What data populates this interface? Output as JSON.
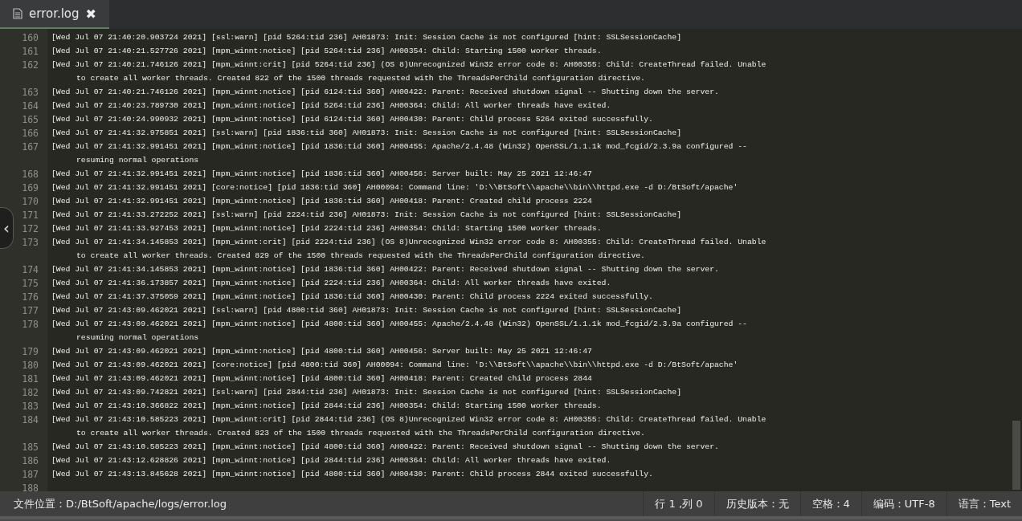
{
  "tabs": [
    {
      "label": "error.log",
      "close": "✖",
      "selected": true
    }
  ],
  "editor": {
    "collapse_handle": "‹",
    "lines": [
      {
        "number": "160",
        "text": "[Wed Jul 07 21:40:20.903724 2021] [ssl:warn] [pid 5264:tid 236] AH01873: Init: Session Cache is not configured [hint: SSLSessionCache]"
      },
      {
        "number": "161",
        "text": "[Wed Jul 07 21:40:21.527726 2021] [mpm_winnt:notice] [pid 5264:tid 236] AH00354: Child: Starting 1500 worker threads."
      },
      {
        "number": "162",
        "text": "[Wed Jul 07 21:40:21.746126 2021] [mpm_winnt:crit] [pid 5264:tid 236] (OS 8)Unrecognized Win32 error code 8: AH00355: Child: CreateThread failed. Unable",
        "wrap": "to create all worker threads. Created 822 of the 1500 threads requested with the ThreadsPerChild configuration directive."
      },
      {
        "number": "163",
        "text": "[Wed Jul 07 21:40:21.746126 2021] [mpm_winnt:notice] [pid 6124:tid 360] AH00422: Parent: Received shutdown signal -- Shutting down the server."
      },
      {
        "number": "164",
        "text": "[Wed Jul 07 21:40:23.789730 2021] [mpm_winnt:notice] [pid 5264:tid 236] AH00364: Child: All worker threads have exited."
      },
      {
        "number": "165",
        "text": "[Wed Jul 07 21:40:24.990932 2021] [mpm_winnt:notice] [pid 6124:tid 360] AH00430: Parent: Child process 5264 exited successfully."
      },
      {
        "number": "166",
        "text": "[Wed Jul 07 21:41:32.975851 2021] [ssl:warn] [pid 1836:tid 360] AH01873: Init: Session Cache is not configured [hint: SSLSessionCache]"
      },
      {
        "number": "167",
        "text": "[Wed Jul 07 21:41:32.991451 2021] [mpm_winnt:notice] [pid 1836:tid 360] AH00455: Apache/2.4.48 (Win32) OpenSSL/1.1.1k mod_fcgid/2.3.9a configured --",
        "wrap": "resuming normal operations"
      },
      {
        "number": "168",
        "text": "[Wed Jul 07 21:41:32.991451 2021] [mpm_winnt:notice] [pid 1836:tid 360] AH00456: Server built: May 25 2021 12:46:47"
      },
      {
        "number": "169",
        "text": "[Wed Jul 07 21:41:32.991451 2021] [core:notice] [pid 1836:tid 360] AH00094: Command line: 'D:\\\\BtSoft\\\\apache\\\\bin\\\\httpd.exe -d D:/BtSoft/apache'"
      },
      {
        "number": "170",
        "text": "[Wed Jul 07 21:41:32.991451 2021] [mpm_winnt:notice] [pid 1836:tid 360] AH00418: Parent: Created child process 2224"
      },
      {
        "number": "171",
        "text": "[Wed Jul 07 21:41:33.272252 2021] [ssl:warn] [pid 2224:tid 236] AH01873: Init: Session Cache is not configured [hint: SSLSessionCache]"
      },
      {
        "number": "172",
        "text": "[Wed Jul 07 21:41:33.927453 2021] [mpm_winnt:notice] [pid 2224:tid 236] AH00354: Child: Starting 1500 worker threads."
      },
      {
        "number": "173",
        "text": "[Wed Jul 07 21:41:34.145853 2021] [mpm_winnt:crit] [pid 2224:tid 236] (OS 8)Unrecognized Win32 error code 8: AH00355: Child: CreateThread failed. Unable",
        "wrap": "to create all worker threads. Created 829 of the 1500 threads requested with the ThreadsPerChild configuration directive."
      },
      {
        "number": "174",
        "text": "[Wed Jul 07 21:41:34.145853 2021] [mpm_winnt:notice] [pid 1836:tid 360] AH00422: Parent: Received shutdown signal -- Shutting down the server."
      },
      {
        "number": "175",
        "text": "[Wed Jul 07 21:41:36.173857 2021] [mpm_winnt:notice] [pid 2224:tid 236] AH00364: Child: All worker threads have exited."
      },
      {
        "number": "176",
        "text": "[Wed Jul 07 21:41:37.375059 2021] [mpm_winnt:notice] [pid 1836:tid 360] AH00430: Parent: Child process 2224 exited successfully."
      },
      {
        "number": "177",
        "text": "[Wed Jul 07 21:43:09.462021 2021] [ssl:warn] [pid 4800:tid 360] AH01873: Init: Session Cache is not configured [hint: SSLSessionCache]"
      },
      {
        "number": "178",
        "text": "[Wed Jul 07 21:43:09.462021 2021] [mpm_winnt:notice] [pid 4800:tid 360] AH00455: Apache/2.4.48 (Win32) OpenSSL/1.1.1k mod_fcgid/2.3.9a configured --",
        "wrap": "resuming normal operations"
      },
      {
        "number": "179",
        "text": "[Wed Jul 07 21:43:09.462021 2021] [mpm_winnt:notice] [pid 4800:tid 360] AH00456: Server built: May 25 2021 12:46:47"
      },
      {
        "number": "180",
        "text": "[Wed Jul 07 21:43:09.462021 2021] [core:notice] [pid 4800:tid 360] AH00094: Command line: 'D:\\\\BtSoft\\\\apache\\\\bin\\\\httpd.exe -d D:/BtSoft/apache'"
      },
      {
        "number": "181",
        "text": "[Wed Jul 07 21:43:09.462021 2021] [mpm_winnt:notice] [pid 4800:tid 360] AH00418: Parent: Created child process 2844"
      },
      {
        "number": "182",
        "text": "[Wed Jul 07 21:43:09.742821 2021] [ssl:warn] [pid 2844:tid 236] AH01873: Init: Session Cache is not configured [hint: SSLSessionCache]"
      },
      {
        "number": "183",
        "text": "[Wed Jul 07 21:43:10.366822 2021] [mpm_winnt:notice] [pid 2844:tid 236] AH00354: Child: Starting 1500 worker threads."
      },
      {
        "number": "184",
        "text": "[Wed Jul 07 21:43:10.585223 2021] [mpm_winnt:crit] [pid 2844:tid 236] (OS 8)Unrecognized Win32 error code 8: AH00355: Child: CreateThread failed. Unable",
        "wrap": "to create all worker threads. Created 823 of the 1500 threads requested with the ThreadsPerChild configuration directive."
      },
      {
        "number": "185",
        "text": "[Wed Jul 07 21:43:10.585223 2021] [mpm_winnt:notice] [pid 4800:tid 360] AH00422: Parent: Received shutdown signal -- Shutting down the server."
      },
      {
        "number": "186",
        "text": "[Wed Jul 07 21:43:12.628826 2021] [mpm_winnt:notice] [pid 2844:tid 236] AH00364: Child: All worker threads have exited."
      },
      {
        "number": "187",
        "text": "[Wed Jul 07 21:43:13.845628 2021] [mpm_winnt:notice] [pid 4800:tid 360] AH00430: Parent: Child process 2844 exited successfully."
      },
      {
        "number": "188"
      }
    ]
  },
  "status_bar": {
    "file_path": "文件位置：D:/BtSoft/apache/logs/error.log",
    "items": [
      "行 1 ,列 0",
      "历史版本：无",
      "空格：4",
      "编码：UTF-8",
      "语言：Text"
    ]
  }
}
